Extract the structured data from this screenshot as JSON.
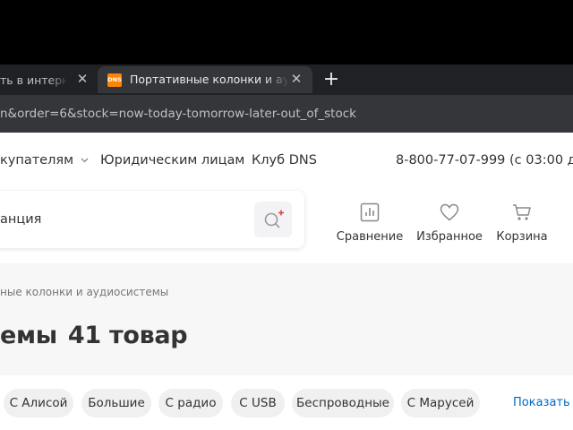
{
  "browser": {
    "tabs": [
      {
        "title": "ть в интернет",
        "active": false
      },
      {
        "title": "Портативные колонки и аудиосистемы",
        "active": true,
        "favicon_text": "DNS"
      }
    ],
    "new_tab_symbol": "+",
    "close_symbol": "✕",
    "url": "n&order=6&stock=now-today-tomorrow-later-out_of_stock"
  },
  "header": {
    "nav": [
      "купателям",
      "Юридическим лицам",
      "Клуб DNS"
    ],
    "phone": "8-800-77-07-999 (с 03:00 до",
    "search_value": "анция",
    "actions": [
      {
        "label": "Сравнение",
        "icon": "compare-icon"
      },
      {
        "label": "Избранное",
        "icon": "heart-icon"
      },
      {
        "label": "Корзина",
        "icon": "cart-icon"
      }
    ]
  },
  "breadcrumb": "ные колонки и аудиосистемы",
  "title": "емы",
  "count": "41 товар",
  "chips": [
    "С Алисой",
    "Большие",
    "С радио",
    "С USB",
    "Беспроводные",
    "С Марусей"
  ],
  "show_all": "Показать е",
  "colors": {
    "accent": "#fc8507",
    "link": "#0069c2",
    "badge": "#e23c3c"
  }
}
